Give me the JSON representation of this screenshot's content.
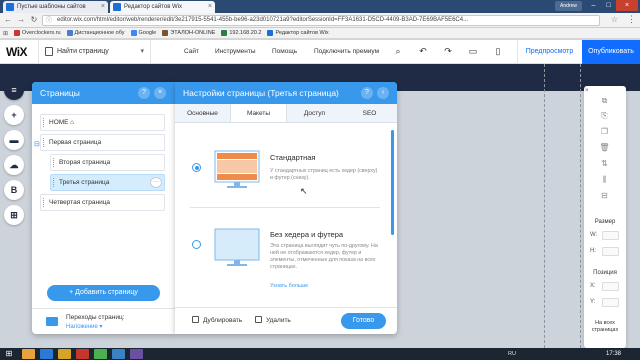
{
  "browser": {
    "tabs": [
      {
        "title": "Пустые шаблоны сайтов"
      },
      {
        "title": "Редактор сайтов Wix"
      }
    ],
    "user": "Andrew",
    "url": "editor.wix.com/html/editor/web/renderer/edit/3e217915-5541-455b-be96-a23d010721a9?editorSessionId=FF3A1631-D5CD-4409-B3AD-7E69BAF5E6C4...",
    "bookmarks": [
      {
        "label": "Overclockers.ru",
        "color": "#d0342c"
      },
      {
        "label": "Дистанционное обу",
        "color": "#4a7bd0"
      },
      {
        "label": "Google",
        "color": "#4285f4"
      },
      {
        "label": "ЭТАЛОН-ONLINE",
        "color": "#7a5230"
      },
      {
        "label": "192.168.20.2",
        "color": "#2d7d46"
      },
      {
        "label": "Редактор сайтов Wix",
        "color": "#1b6fd6"
      }
    ]
  },
  "wix_bar": {
    "logo": "WiX",
    "page_selector": "Найти страницу",
    "menu": [
      "Сайт",
      "Инструменты",
      "Помощь",
      "Подключить премиум"
    ],
    "preview": "Предпросмотр",
    "publish": "Опубликовать"
  },
  "left_tools": [
    "≡",
    "+",
    "▬",
    "☁",
    "B",
    "⊞"
  ],
  "pages_panel": {
    "title": "Страницы",
    "items": [
      {
        "label": "HOME ⌂",
        "level": 0
      },
      {
        "label": "Первая страница",
        "level": 0
      },
      {
        "label": "Вторая страница",
        "level": 1
      },
      {
        "label": "Третья страница",
        "level": 1,
        "selected": true
      },
      {
        "label": "Четвертая страница",
        "level": 0
      }
    ],
    "add_button": "+ Добавить страницу",
    "transitions_label": "Переходы страниц:",
    "transitions_value": "Наложение ▾"
  },
  "settings_panel": {
    "title": "Настройки страницы (Третья страница)",
    "tabs": [
      "Основные",
      "Макеты",
      "Доступ",
      "SEO"
    ],
    "active_tab": 1,
    "options": [
      {
        "title": "Стандартная",
        "desc": "У стандартных страниц есть хедер (сверху) и футер (снизу).",
        "selected": true
      },
      {
        "title": "Без хедера и футера",
        "desc": "Эта страница выглядит чуть по-другому. На ней не отображаются хедер, футер и элементы, отмеченные для показа на всех страницах.",
        "link": "Узнать больше",
        "selected": false
      }
    ],
    "duplicate": "Дублировать",
    "delete": "Удалить",
    "done": "Готово"
  },
  "right_tools": {
    "size_label": "Размер",
    "w_key": "W:",
    "h_key": "H:",
    "position_label": "Позиция",
    "x_key": "X:",
    "y_key": "Y:",
    "all_pages": "На всех страницах"
  },
  "taskbar": {
    "lang": "RU",
    "time": "17:38"
  },
  "colors": {
    "accent": "#3899ec",
    "publish": "#116dff",
    "canvas_dark": "#1f2b44"
  }
}
